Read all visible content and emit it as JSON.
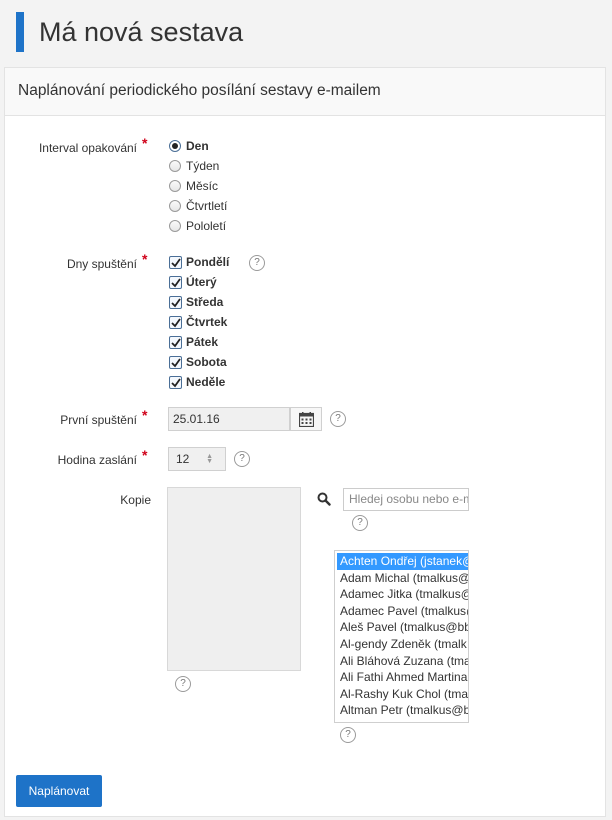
{
  "header": {
    "title": "Má nová sestava"
  },
  "panel": {
    "title": "Naplánování periodického posílání sestavy e-mailem"
  },
  "form": {
    "interval": {
      "label": "Interval opakování",
      "options": [
        "Den",
        "Týden",
        "Měsíc",
        "Čtvrtletí",
        "Pololetí"
      ],
      "selected": "Den"
    },
    "days": {
      "label": "Dny spuštění",
      "options": [
        "Pondělí",
        "Úterý",
        "Středa",
        "Čtvrtek",
        "Pátek",
        "Sobota",
        "Neděle"
      ],
      "all_checked": true
    },
    "first_run": {
      "label": "První spuštění",
      "value": "25.01.16"
    },
    "hour": {
      "label": "Hodina zaslání",
      "value": "12"
    },
    "copies": {
      "label": "Kopie",
      "search_placeholder": "Hledej osobu nebo e-mail",
      "people": [
        "Achten Ondřej (jstanek@",
        "Adam Michal (tmalkus@",
        "Adamec Jitka (tmalkus@",
        "Adamec Pavel (tmalkus@",
        "Aleš Pavel (tmalkus@bb",
        "Al-gendy Zdeněk (tmalk",
        "Ali Bláhová Zuzana (tma",
        "Ali Fathi Ahmed Martina",
        "Al-Rashy Kuk Chol (tma",
        "Altman Petr (tmalkus@b"
      ],
      "selected_person": "Achten Ondřej (jstanek@"
    },
    "help_symbol": "?",
    "required_mark": "*",
    "submit_label": "Naplánovat"
  },
  "colors": {
    "accent": "#1e73c8",
    "required": "#d0021b",
    "selection": "#3399ff"
  }
}
